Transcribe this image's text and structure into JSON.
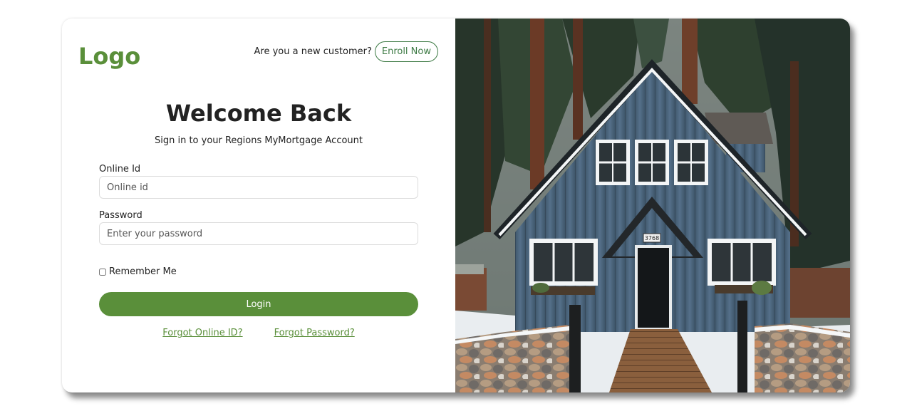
{
  "brand": {
    "logo_text": "Logo"
  },
  "header": {
    "new_customer_text": "Are you a new customer?",
    "enroll_label": "Enroll Now"
  },
  "form": {
    "title": "Welcome Back",
    "subtitle": "Sign in to your Regions MyMortgage Account",
    "online_id": {
      "label": "Online Id",
      "placeholder": "Online id",
      "value": ""
    },
    "password": {
      "label": "Password",
      "placeholder": "Enter your password",
      "value": ""
    },
    "remember_label": "Remember Me",
    "remember_checked": false,
    "login_label": "Login",
    "forgot_id_label": "Forgot Online ID?",
    "forgot_password_label": "Forgot Password?"
  },
  "hero": {
    "house_number": "3768"
  },
  "colors": {
    "accent": "#5a8f3a",
    "enroll_border": "#3e7b45",
    "house_siding": "#4b6478",
    "text": "#222222"
  }
}
